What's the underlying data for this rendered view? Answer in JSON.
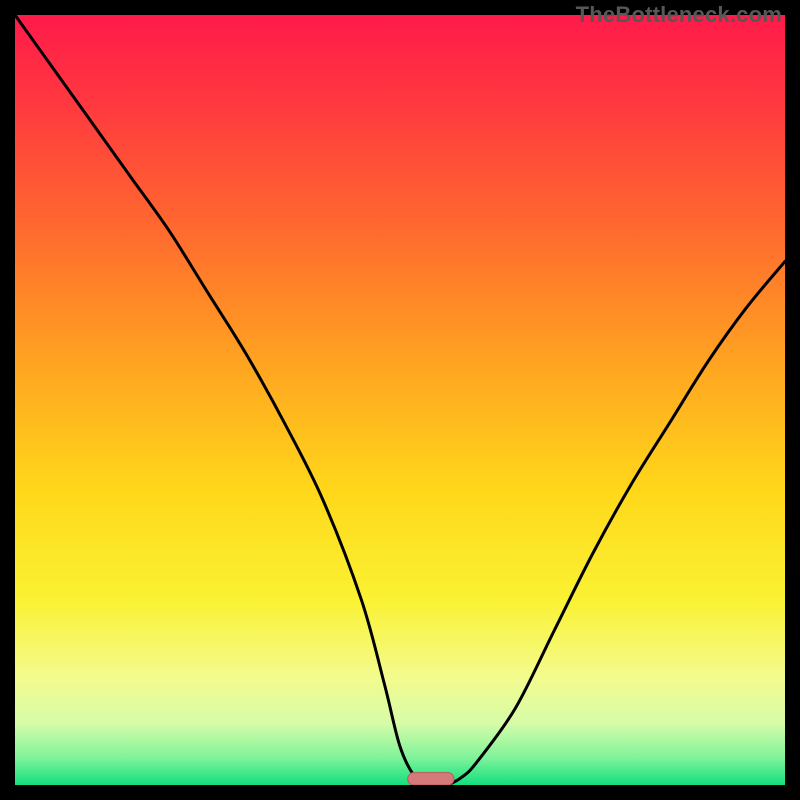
{
  "watermark": "TheBottleneck.com",
  "colors": {
    "gradient_stops": [
      {
        "offset": 0.0,
        "color": "#ff1a4a"
      },
      {
        "offset": 0.12,
        "color": "#ff3a3f"
      },
      {
        "offset": 0.28,
        "color": "#ff6a2e"
      },
      {
        "offset": 0.45,
        "color": "#ffa321"
      },
      {
        "offset": 0.62,
        "color": "#ffd81a"
      },
      {
        "offset": 0.76,
        "color": "#faf233"
      },
      {
        "offset": 0.86,
        "color": "#f3fb8d"
      },
      {
        "offset": 0.92,
        "color": "#d6fca8"
      },
      {
        "offset": 0.965,
        "color": "#7ef39a"
      },
      {
        "offset": 1.0,
        "color": "#13e07e"
      }
    ],
    "curve": "#000000",
    "marker_fill": "#d47a7a",
    "marker_stroke": "#c05858",
    "frame_bg": "#000000"
  },
  "chart_data": {
    "type": "line",
    "title": "",
    "xlabel": "",
    "ylabel": "",
    "xlim": [
      0,
      100
    ],
    "ylim": [
      0,
      100
    ],
    "series": [
      {
        "name": "bottleneck-curve",
        "x": [
          0,
          5,
          10,
          15,
          20,
          25,
          30,
          35,
          40,
          45,
          48,
          50,
          52,
          54,
          56,
          58,
          60,
          65,
          70,
          75,
          80,
          85,
          90,
          95,
          100
        ],
        "y": [
          100,
          93,
          86,
          79,
          72,
          64,
          56,
          47,
          37,
          24,
          13,
          5,
          1,
          0,
          0,
          1,
          3,
          10,
          20,
          30,
          39,
          47,
          55,
          62,
          68
        ]
      }
    ],
    "marker": {
      "x_center": 54,
      "y": 0,
      "width_x": 6,
      "height_y": 1.6
    }
  }
}
